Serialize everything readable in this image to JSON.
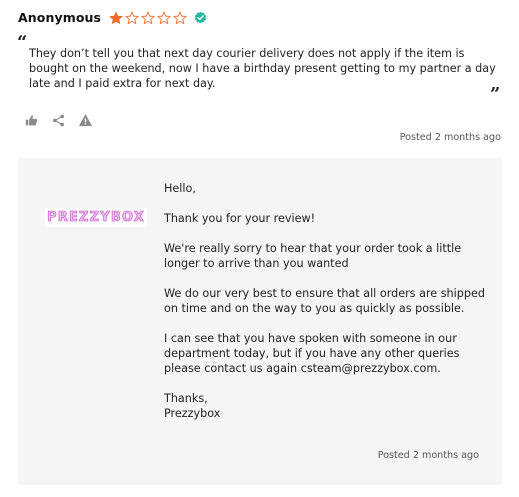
{
  "review": {
    "author": "Anonymous",
    "rating": 1,
    "max_rating": 5,
    "star_filled_color": "#f26b2d",
    "star_empty_color": "#f26b2d",
    "verified_color": "#29b6a0",
    "icons": {
      "verified": "verified-check-icon",
      "like": "thumbs-up-icon",
      "share": "share-icon",
      "report": "warning-icon"
    },
    "text": "They don’t tell you that next day courier delivery does not apply if the item is bought on the weekend, now I have a birthday present getting to my partner a day late and I paid extra for next day.",
    "quote_open": "“",
    "quote_close": "”",
    "posted": "Posted 2 months ago"
  },
  "reply": {
    "brand_logo": "PREZZYBOX",
    "greeting": "Hello,",
    "paragraphs": [
      "Thank you for your review!",
      "We're really sorry to hear that your order took a little longer to arrive than you wanted",
      "We do our very best to ensure that all orders are shipped on time and on the way to you as quickly as possible.",
      "I can see that you have spoken with someone in our department today, but if you have any other queries please contact us again csteam@prezzybox.com."
    ],
    "signoff_line1": "Thanks,",
    "signoff_line2": "Prezzybox",
    "posted": "Posted 2 months ago"
  }
}
